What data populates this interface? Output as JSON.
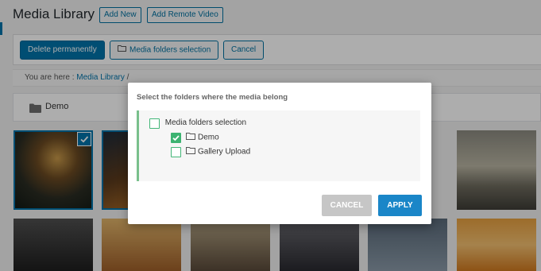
{
  "header": {
    "title": "Media Library",
    "add_new": "Add New",
    "add_remote_video": "Add Remote Video"
  },
  "toolbar": {
    "delete_permanently": "Delete permanently",
    "media_folders_selection": "Media folders selection",
    "cancel": "Cancel"
  },
  "breadcrumb": {
    "prefix": "You are here",
    "separator": ":",
    "item": "Media Library",
    "trailing": "/"
  },
  "folders": {
    "demo_label": "Demo"
  },
  "dialog": {
    "title": "Select the folders where the media belong",
    "root": {
      "label": "Media folders selection",
      "checked": false
    },
    "children": [
      {
        "label": "Demo",
        "checked": true
      },
      {
        "label": "Gallery Upload",
        "checked": false
      }
    ],
    "cancel_label": "CANCEL",
    "apply_label": "APPLY"
  },
  "colors": {
    "wp_blue": "#0073aa",
    "apply_blue": "#1a86c8",
    "check_green": "#3cb371",
    "cancel_gray": "#c6c6c6",
    "tree_border": "#79c08c"
  },
  "icons": {
    "selected_check": "check-icon",
    "folder": "folder-icon"
  }
}
